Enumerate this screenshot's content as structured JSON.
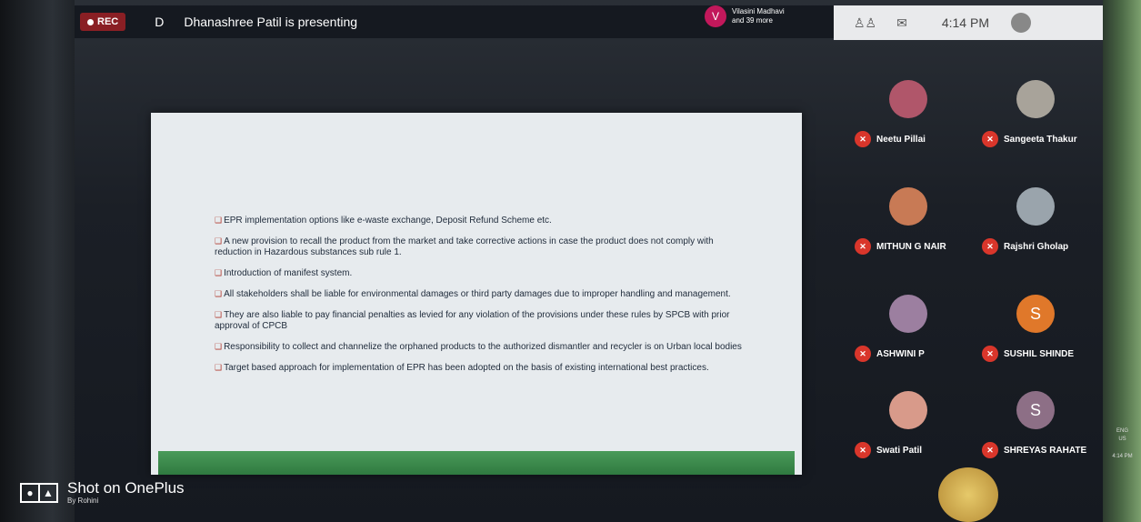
{
  "topbar": {
    "rec_label": "REC",
    "presenter_initial": "D",
    "presenting_text": "Dhanashree Patil is presenting",
    "participants_avatar": "V",
    "participants_line1": "Vilasini Madhavi",
    "participants_line2": "and 39 more",
    "clock": "4:14 PM"
  },
  "slide": {
    "bullets": [
      "EPR implementation options like e-waste exchange, Deposit Refund Scheme etc.",
      "A new provision to recall the product from the market and take corrective actions in case the product does not comply with reduction in Hazardous substances sub rule 1.",
      "Introduction of manifest system.",
      "All stakeholders shall be liable for environmental damages or third party damages due to improper handling and management.",
      "They are also liable to pay financial penalties as levied for any violation of the provisions under these rules by SPCB with prior approval of CPCB",
      "Responsibility to collect and channelize the orphaned products to the authorized dismantler and recycler is on Urban local bodies",
      "Target based approach for implementation of EPR has been adopted on the basis of existing international best practices."
    ]
  },
  "participants": [
    {
      "name": "Neetu Pillai",
      "initial": "",
      "color": "#b0566a"
    },
    {
      "name": "Sangeeta Thakur",
      "initial": "",
      "color": "#a8a39a"
    },
    {
      "name": "MITHUN G NAIR",
      "initial": "",
      "color": "#c87a55"
    },
    {
      "name": "Rajshri Gholap",
      "initial": "",
      "color": "#9aa4ac"
    },
    {
      "name": "ASHWINI P",
      "initial": "",
      "color": "#9c7fa0"
    },
    {
      "name": "SUSHIL SHINDE",
      "initial": "S",
      "color": "#e0782a"
    },
    {
      "name": "Swati Patil",
      "initial": "",
      "color": "#d89a8a"
    },
    {
      "name": "SHREYAS RAHATE",
      "initial": "S",
      "color": "#8d6f86"
    }
  ],
  "watermark": {
    "title": "Shot on OnePlus",
    "subtitle": "By Rohini"
  },
  "tray": {
    "lang": "ENG",
    "region": "US",
    "time": "4:14 PM"
  }
}
